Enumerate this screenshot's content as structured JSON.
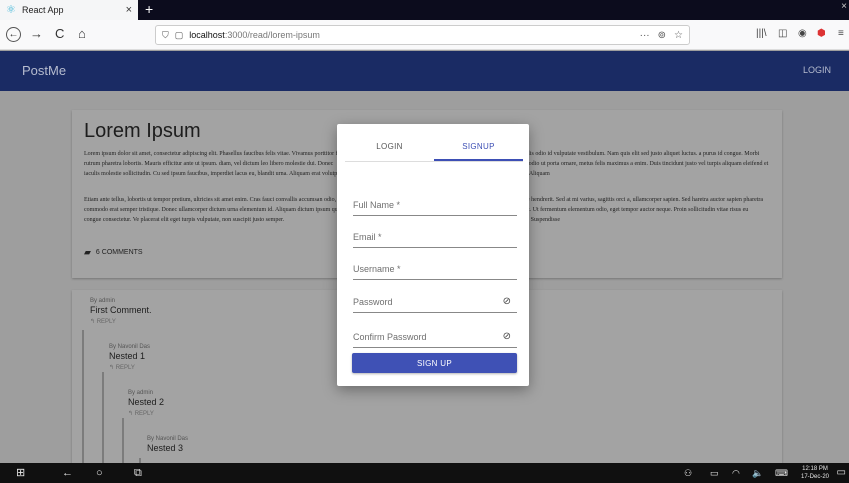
{
  "browser": {
    "tab_title": "React App",
    "tab_close": "×",
    "new_tab": "+",
    "window_close": "×",
    "back": "←",
    "forward": "→",
    "reload": "C",
    "home": "⌂",
    "url_host": "localhost",
    "url_path": ":3000/read/lorem-ipsum",
    "url_more": "···",
    "toolbar_icons": [
      "library-icon",
      "sidebar-icon",
      "account-icon",
      "shield-icon",
      "menu-icon"
    ]
  },
  "appbar": {
    "brand": "PostMe",
    "login": "LOGIN"
  },
  "post": {
    "title": "Lorem Ipsum",
    "paragraph1_left": "Lorem ipsum dolor sit amet, consectetur adipiscing elit. Phasellus faucibus felis vitae. Vivamus porttitor felis rutrum pharetra lobortis. Mauris efficitur ante ut ipsum. diam, vel dictum leo libero molestie dui. Donec iaculis molestie sollicitudin. Cu sed ipsum faucibus, imperdiet lacus eu, blandit urna. Aliquam erat volutpat.",
    "paragraph1_right": "que iaculis odio id vulputate vestibulum. Nam quis elit sed justo aliquet luctus. a purus id congue. Morbi ultrices, odio ut porta ornare, metus felis maximus a enim. Duis tincidunt justo vel turpis aliquam eleifend et in enim. Aliquam",
    "paragraph2_left": "Etiam ante tellus, lobortis ut tempor pretium, ultricies sit amet enim. Cras fauci convallis accumsan odio, eu commodo erat semper tristique. Donec ullamcorper dictum urna elementum id. Aliquam dictum ipsum quis congue consectetur. Ve placerat elit eget turpis vulputate, non suscipit justo semper.",
    "paragraph2_right": "elerisque hendrerit. Sed at mi varius, sagittis orci a, ullamcorper sapien. Sed haretra auctor sapien pharetra hendrerit. Ut fermentum elementum odio, eget tempor auctor neque. Proin sollicitudin vitae risus eu tristique. Suspendisse",
    "comments_label": "6 COMMENTS"
  },
  "comments": [
    {
      "author": "By admin",
      "text": "First Comment.",
      "reply": "REPLY"
    },
    {
      "author": "By Navonil Das",
      "text": "Nested 1",
      "reply": "REPLY"
    },
    {
      "author": "By admin",
      "text": "Nested 2",
      "reply": "REPLY"
    },
    {
      "author": "By Navonil Das",
      "text": "Nested 3",
      "reply": ""
    }
  ],
  "modal": {
    "tabs": [
      "LOGIN",
      "SIGNUP"
    ],
    "active_tab": "SIGNUP",
    "fields": {
      "full_name": "Full Name *",
      "email": "Email *",
      "username": "Username *",
      "password": "Password",
      "confirm_password": "Confirm Password"
    },
    "submit": "SIGN UP"
  },
  "taskbar": {
    "time": "12:18 PM",
    "date": "17-Dec-20"
  },
  "colors": {
    "primary": "#3f51b5",
    "appbar": "#1a2b64"
  }
}
